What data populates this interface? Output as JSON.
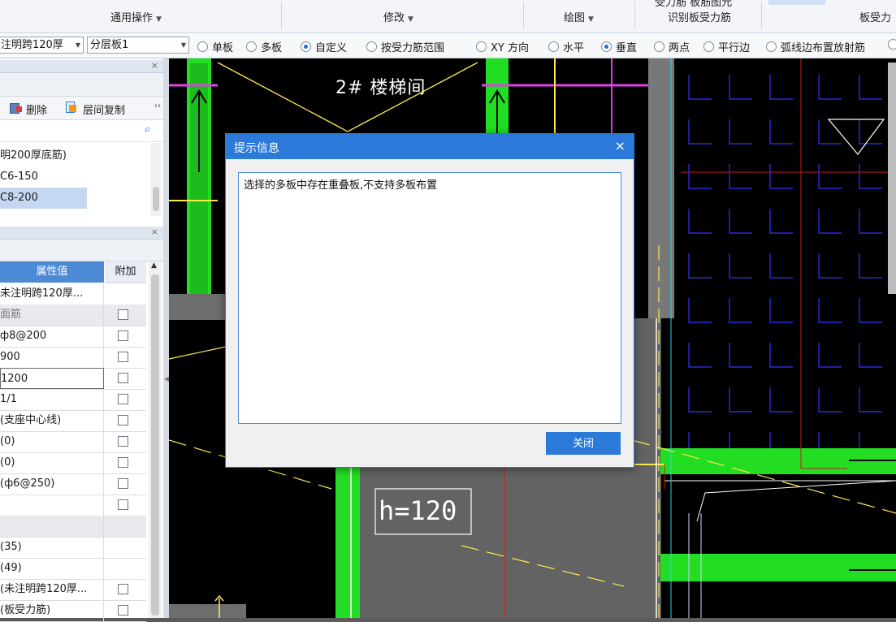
{
  "ribbon": {
    "groups": [
      "通用操作",
      "修改",
      "绘图",
      "识别板受力筋",
      "板受力"
    ],
    "top_partial": "受力筋  板筋图元"
  },
  "options": {
    "floor_combo": "注明跨120厚",
    "layer_combo": "分层板1",
    "radios": [
      {
        "label": "单板",
        "checked": false
      },
      {
        "label": "多板",
        "checked": false
      },
      {
        "label": "自定义",
        "checked": true
      },
      {
        "label": "按受力筋范围",
        "checked": false
      },
      {
        "label": "XY 方向",
        "checked": false
      },
      {
        "label": "水平",
        "checked": false
      },
      {
        "label": "垂直",
        "checked": true
      },
      {
        "label": "两点",
        "checked": false
      },
      {
        "label": "平行边",
        "checked": false
      },
      {
        "label": "弧线边布置放射筋",
        "checked": false
      }
    ]
  },
  "component_panel": {
    "delete_label": "删除",
    "copy_label": "层间复制",
    "more": "››",
    "items": [
      "明200厚底筋)",
      "C6-150",
      "C8-200"
    ],
    "selected_index": 2
  },
  "property_panel": {
    "header_value": "属性值",
    "header_extra": "附加",
    "rows": [
      {
        "value": "未注明跨120厚...",
        "chk": false,
        "gray": false
      },
      {
        "value": "面筋",
        "chk": true,
        "gray": true
      },
      {
        "value": "ф8@200",
        "chk": true,
        "gray": false
      },
      {
        "value": "900",
        "chk": true,
        "gray": false
      },
      {
        "value": "1200",
        "chk": true,
        "gray": false,
        "editing": true
      },
      {
        "value": "1/1",
        "chk": true,
        "gray": false
      },
      {
        "value": "(支座中心线)",
        "chk": true,
        "gray": false
      },
      {
        "value": "(0)",
        "chk": true,
        "gray": false
      },
      {
        "value": "(0)",
        "chk": true,
        "gray": false
      },
      {
        "value": "(ф6@250)",
        "chk": true,
        "gray": false
      },
      {
        "value": "",
        "chk": true,
        "gray": false
      },
      {
        "value": "",
        "chk": false,
        "gray": true
      },
      {
        "value": "(35)",
        "chk": false,
        "gray": false
      },
      {
        "value": "(49)",
        "chk": false,
        "gray": false
      },
      {
        "value": "(未注明跨120厚...",
        "chk": true,
        "gray": false
      },
      {
        "value": "(板受力筋)",
        "chk": true,
        "gray": false
      }
    ]
  },
  "canvas": {
    "label_stair": "2# 楼梯间",
    "label_h": "h=120"
  },
  "dialog": {
    "title": "提示信息",
    "close_glyph": "×",
    "message": "选择的多板中存在重叠板,不支持多板布置",
    "button": "关闭"
  },
  "colors": {
    "accent": "#2b79d8",
    "cad_green": "#22dd22",
    "cad_blue": "#2a2ad8",
    "cad_yellow": "#ffe94d",
    "cad_magenta": "#e040e0",
    "cad_red": "#d01818"
  }
}
